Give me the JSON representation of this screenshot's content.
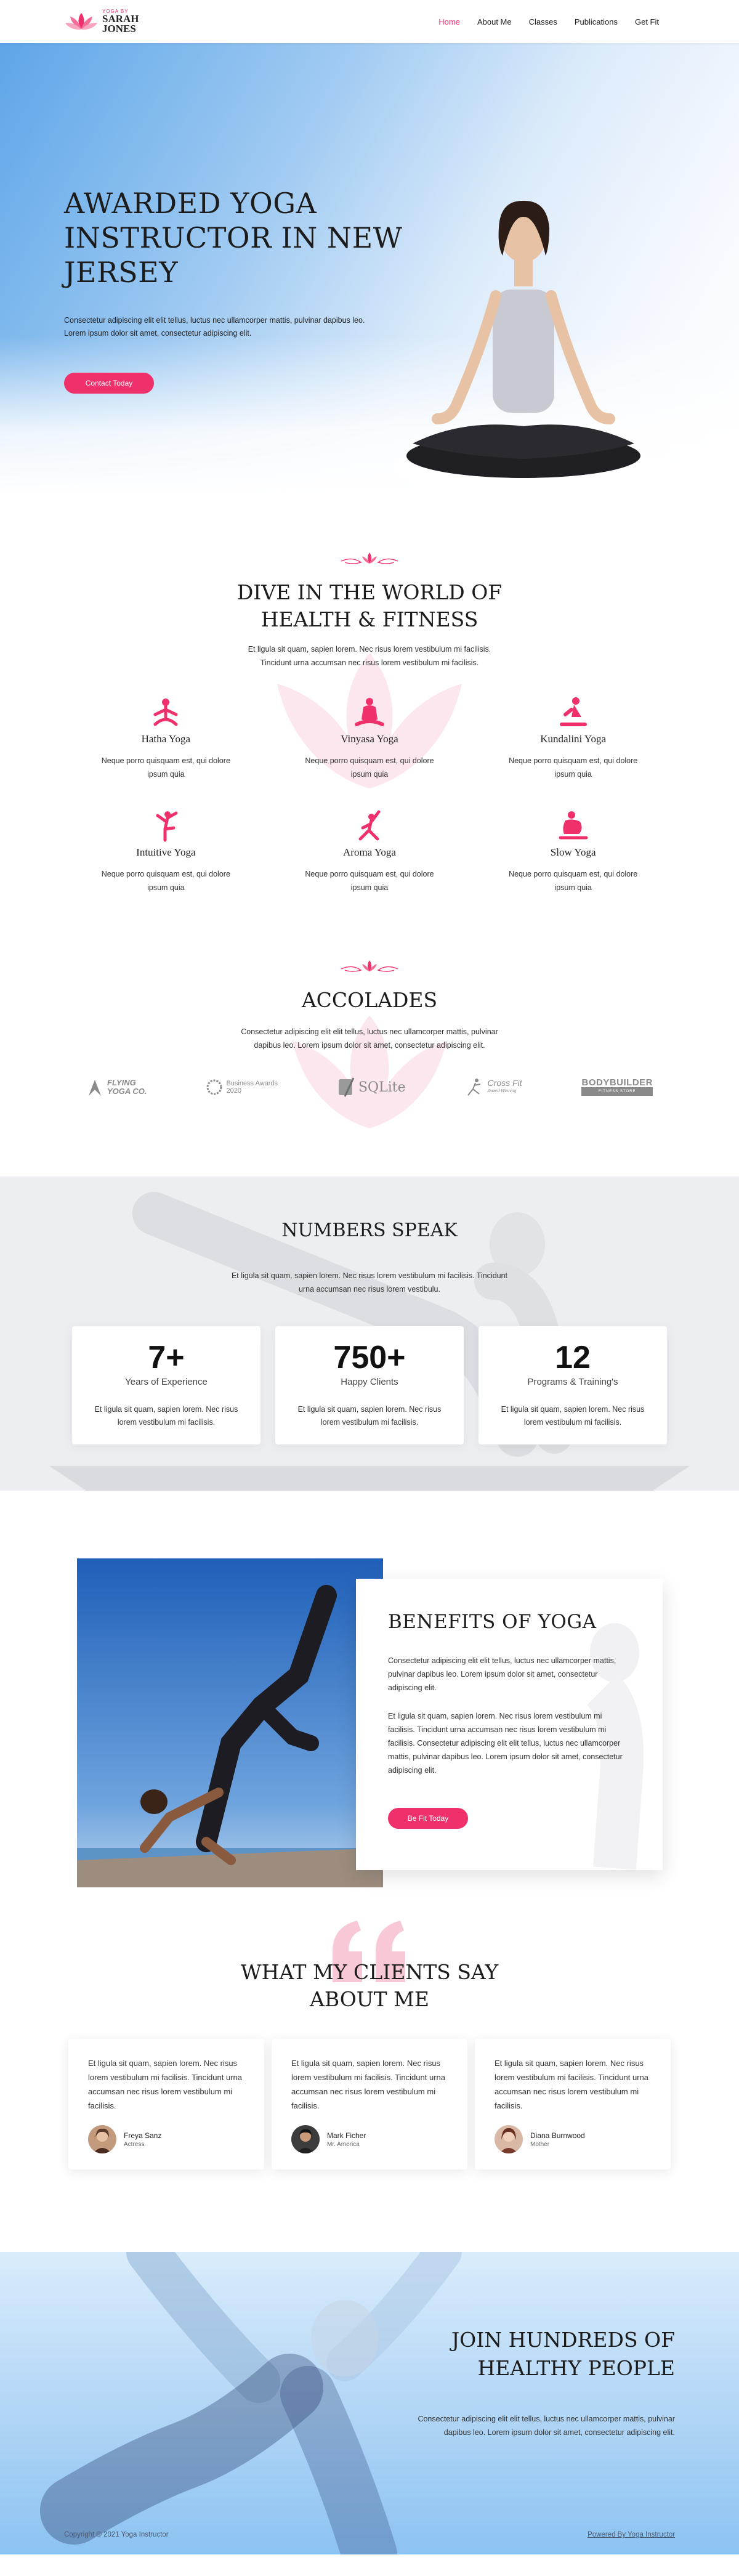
{
  "header": {
    "logo_small": "YOGA BY",
    "logo_line1": "SARAH",
    "logo_line2": "JONES",
    "nav": [
      {
        "label": "Home",
        "active": true
      },
      {
        "label": "About Me",
        "active": false
      },
      {
        "label": "Classes",
        "active": false
      },
      {
        "label": "Publications",
        "active": false
      },
      {
        "label": "Get Fit",
        "active": false
      }
    ]
  },
  "hero": {
    "title": "AWARDED YOGA INSTRUCTOR IN NEW JERSEY",
    "text": "Consectetur adipiscing elit elit tellus, luctus nec ullamcorper mattis, pulvinar dapibus leo. Lorem ipsum dolor sit amet, consectetur adipiscing elit.",
    "button": "Contact Today"
  },
  "dive": {
    "title_line1": "DIVE IN THE WORLD OF",
    "title_line2": "HEALTH & FITNESS",
    "subtitle": "Et ligula sit quam, sapien lorem. Nec risus lorem vestibulum mi facilisis. Tincidunt urna accumsan nec risus lorem vestibulum mi facilisis.",
    "items": [
      {
        "name": "Hatha Yoga",
        "desc": "Neque porro quisquam est, qui dolore ipsum quia",
        "icon": "hatha-yoga-icon"
      },
      {
        "name": "Vinyasa Yoga",
        "desc": "Neque porro quisquam est, qui dolore ipsum quia",
        "icon": "vinyasa-yoga-icon"
      },
      {
        "name": "Kundalini Yoga",
        "desc": "Neque porro quisquam est, qui dolore ipsum quia",
        "icon": "kundalini-yoga-icon"
      },
      {
        "name": "Intuitive Yoga",
        "desc": "Neque porro quisquam est, qui dolore ipsum quia",
        "icon": "intuitive-yoga-icon"
      },
      {
        "name": "Aroma Yoga",
        "desc": "Neque porro quisquam est, qui dolore ipsum quia",
        "icon": "aroma-yoga-icon"
      },
      {
        "name": "Slow Yoga",
        "desc": "Neque porro quisquam est, qui dolore ipsum quia",
        "icon": "slow-yoga-icon"
      }
    ]
  },
  "accolades": {
    "title": "ACCOLADES",
    "subtitle": "Consectetur adipiscing elit elit tellus, luctus nec ullamcorper mattis, pulvinar dapibus leo. Lorem ipsum dolor sit amet, consectetur adipiscing elit.",
    "logos": [
      {
        "line1": "FLYING",
        "line2": "YOGA CO."
      },
      {
        "line1": "Business Awards",
        "line2": "2020"
      },
      {
        "line1": "SQLite",
        "line2": ""
      },
      {
        "line1": "Cross Fit",
        "line2": "Award Winning"
      },
      {
        "line1": "BODYBUILDER",
        "line2": "FITNESS STORE"
      }
    ]
  },
  "numbers": {
    "title": "NUMBERS SPEAK",
    "subtitle": "Et ligula sit quam, sapien lorem. Nec risus lorem vestibulum mi facilisis. Tincidunt urna accumsan nec risus lorem vestibulu.",
    "stats": [
      {
        "value": "7+",
        "label": "Years of Experience",
        "desc": "Et ligula sit quam, sapien lorem. Nec risus lorem vestibulum mi facilisis."
      },
      {
        "value": "750+",
        "label": "Happy Clients",
        "desc": "Et ligula sit quam, sapien lorem. Nec risus lorem vestibulum mi facilisis."
      },
      {
        "value": "12",
        "label": "Programs & Training's",
        "desc": "Et ligula sit quam, sapien lorem. Nec risus lorem vestibulum mi facilisis."
      }
    ]
  },
  "benefits": {
    "title": "BENEFITS OF YOGA",
    "p1": "Consectetur adipiscing elit elit tellus, luctus nec ullamcorper mattis, pulvinar dapibus leo. Lorem ipsum dolor sit amet, consectetur adipiscing elit.",
    "p2": "Et ligula sit quam, sapien lorem. Nec risus lorem vestibulum mi facilisis. Tincidunt urna accumsan nec risus lorem vestibulum mi facilisis. Consectetur adipiscing elit elit tellus, luctus nec ullamcorper mattis, pulvinar dapibus leo. Lorem ipsum dolor sit amet, consectetur adipiscing elit.",
    "button": "Be Fit Today"
  },
  "testimonials": {
    "title_line1": "WHAT MY CLIENTS SAY",
    "title_line2": "ABOUT ME",
    "items": [
      {
        "quote": "Et ligula sit quam, sapien lorem. Nec risus lorem vestibulum mi facilisis. Tincidunt urna accumsan nec risus lorem vestibulum mi facilisis.",
        "name": "Freya Sanz",
        "role": "Actress"
      },
      {
        "quote": "Et ligula sit quam, sapien lorem. Nec risus lorem vestibulum mi facilisis. Tincidunt urna accumsan nec risus lorem vestibulum mi facilisis.",
        "name": "Mark Ficher",
        "role": "Mr. America"
      },
      {
        "quote": "Et ligula sit quam, sapien lorem. Nec risus lorem vestibulum mi facilisis. Tincidunt urna accumsan nec risus lorem vestibulum mi facilisis.",
        "name": "Diana Burnwood",
        "role": "Mother"
      }
    ]
  },
  "join": {
    "title_line1": "JOIN HUNDREDS OF",
    "title_line2": "HEALTHY PEOPLE",
    "text": "Consectetur adipiscing elit elit tellus, luctus nec ullamcorper mattis, pulvinar dapibus leo. Lorem ipsum dolor sit amet, consectetur adipiscing elit."
  },
  "footer": {
    "copyright": "Copyright © 2021 Yoga Instructor",
    "powered": "Powered By Yoga Instructor"
  },
  "colors": {
    "accent": "#f0306b",
    "brand_pink": "#e8336d",
    "numbers_bg": "#eceef2",
    "sky_blue": "#5ea6e8"
  }
}
